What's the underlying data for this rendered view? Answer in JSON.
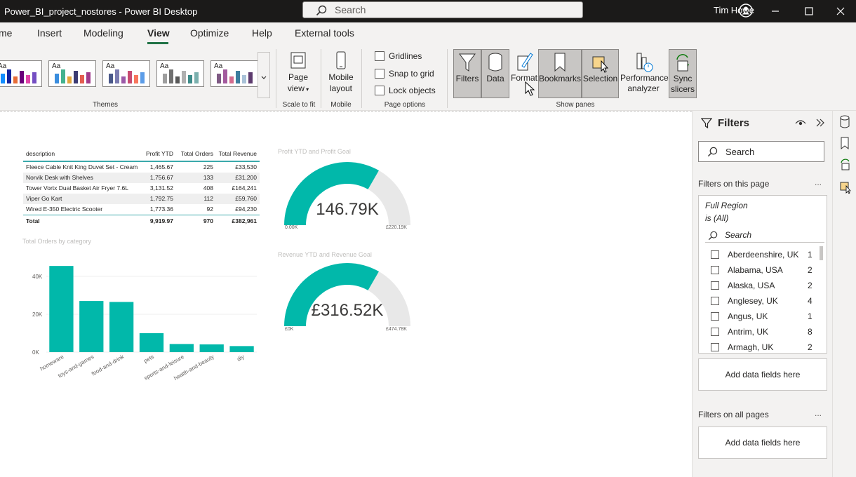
{
  "titlebar": {
    "title": "Power_BI_project_nostores - Power BI Desktop",
    "search_placeholder": "Search",
    "user": "Tim Howe"
  },
  "menu": {
    "tabs": [
      "me",
      "Insert",
      "Modeling",
      "View",
      "Optimize",
      "Help",
      "External tools"
    ],
    "active": "View"
  },
  "ribbon": {
    "themes": {
      "label": "Themes",
      "swatch_text": "Aa",
      "palettes": [
        [
          "#118dff",
          "#12239e",
          "#e66c37",
          "#6b007b",
          "#e044a7",
          "#744ec2"
        ],
        [
          "#3a8dde",
          "#43b28f",
          "#e2a53a",
          "#3b3b73",
          "#e45d50",
          "#a13a8b"
        ],
        [
          "#4a588a",
          "#7a7bb0",
          "#9c5aa8",
          "#c74b72",
          "#f7775e",
          "#5c9de8"
        ],
        [
          "#9e9e9e",
          "#707070",
          "#585858",
          "#b0b0b0",
          "#3e8c8a",
          "#7bb0ae"
        ],
        [
          "#7f5a84",
          "#a35a9e",
          "#d36b8e",
          "#3c7d9e",
          "#a9c2d8",
          "#5d3b6e"
        ]
      ]
    },
    "scale": {
      "btn": "Page",
      "btn2": "view",
      "label": "Scale to fit"
    },
    "mobile": {
      "btn": "Mobile",
      "btn2": "layout",
      "label": "Mobile"
    },
    "page_options": {
      "gridlines": "Gridlines",
      "snap": "Snap to grid",
      "lock": "Lock objects",
      "label": "Page options"
    },
    "show_panes": {
      "label": "Show panes",
      "filters": "Filters",
      "data": "Data",
      "format": "Format",
      "bookmarks": "Bookmarks",
      "selection": "Selection",
      "perf1": "Performance",
      "perf2": "analyzer",
      "sync1": "Sync",
      "sync2": "slicers"
    }
  },
  "table": {
    "headers": [
      "description",
      "Profit YTD",
      "Total Orders",
      "Total Revenue"
    ],
    "rows": [
      [
        "Fleece Cable Knit King Duvet Set - Cream",
        "1,465.67",
        "225",
        "£33,530"
      ],
      [
        "Norvik Desk with Shelves",
        "1,756.67",
        "133",
        "£31,200"
      ],
      [
        "Tower Vortx Dual Basket Air Fryer 7.6L",
        "3,131.52",
        "408",
        "£164,241"
      ],
      [
        "Viper Go Kart",
        "1,792.75",
        "112",
        "£59,760"
      ],
      [
        "Wired E-350 Electric Scooter",
        "1,773.36",
        "92",
        "£94,230"
      ]
    ],
    "total": [
      "Total",
      "9,919.97",
      "970",
      "£382,961"
    ]
  },
  "chart_data": [
    {
      "type": "bar",
      "title": "Total Orders by category",
      "categories": [
        "homeware",
        "toys-and-games",
        "food-and-drink",
        "pets",
        "sports-and-leisure",
        "health-and-beauty",
        "diy"
      ],
      "values": [
        45500,
        27000,
        26500,
        10000,
        4300,
        4100,
        3200
      ],
      "yticks": [
        "40K",
        "20K",
        "0K"
      ],
      "ylim": [
        0,
        50000
      ],
      "color": "#01b8aa"
    },
    {
      "type": "gauge",
      "title": "Profit YTD and Profit Goal",
      "value": 146.79,
      "min": 0,
      "max": 220.19,
      "value_label": "146.79K",
      "min_label": "0.00K",
      "max_label": "£220.19K",
      "color": "#01b8aa"
    },
    {
      "type": "gauge",
      "title": "Revenue YTD and Revenue Goal",
      "value": 316.52,
      "min": 0,
      "max": 474.78,
      "value_label": "£316.52K",
      "min_label": "£0K",
      "max_label": "£474.78K",
      "color": "#01b8aa"
    }
  ],
  "filters": {
    "title": "Filters",
    "search": "Search",
    "on_page": "Filters on this page",
    "card_field": "Full Region",
    "card_condition": "is (All)",
    "card_search": "Search",
    "items": [
      [
        "Aberdeenshire, UK",
        "1"
      ],
      [
        "Alabama, USA",
        "2"
      ],
      [
        "Alaska, USA",
        "2"
      ],
      [
        "Anglesey, UK",
        "4"
      ],
      [
        "Angus, UK",
        "1"
      ],
      [
        "Antrim, UK",
        "8"
      ],
      [
        "Armagh, UK",
        "2"
      ]
    ],
    "add_fields": "Add data fields here",
    "on_all": "Filters on all pages",
    "add_fields2": "Add data fields here",
    "more": "..."
  }
}
